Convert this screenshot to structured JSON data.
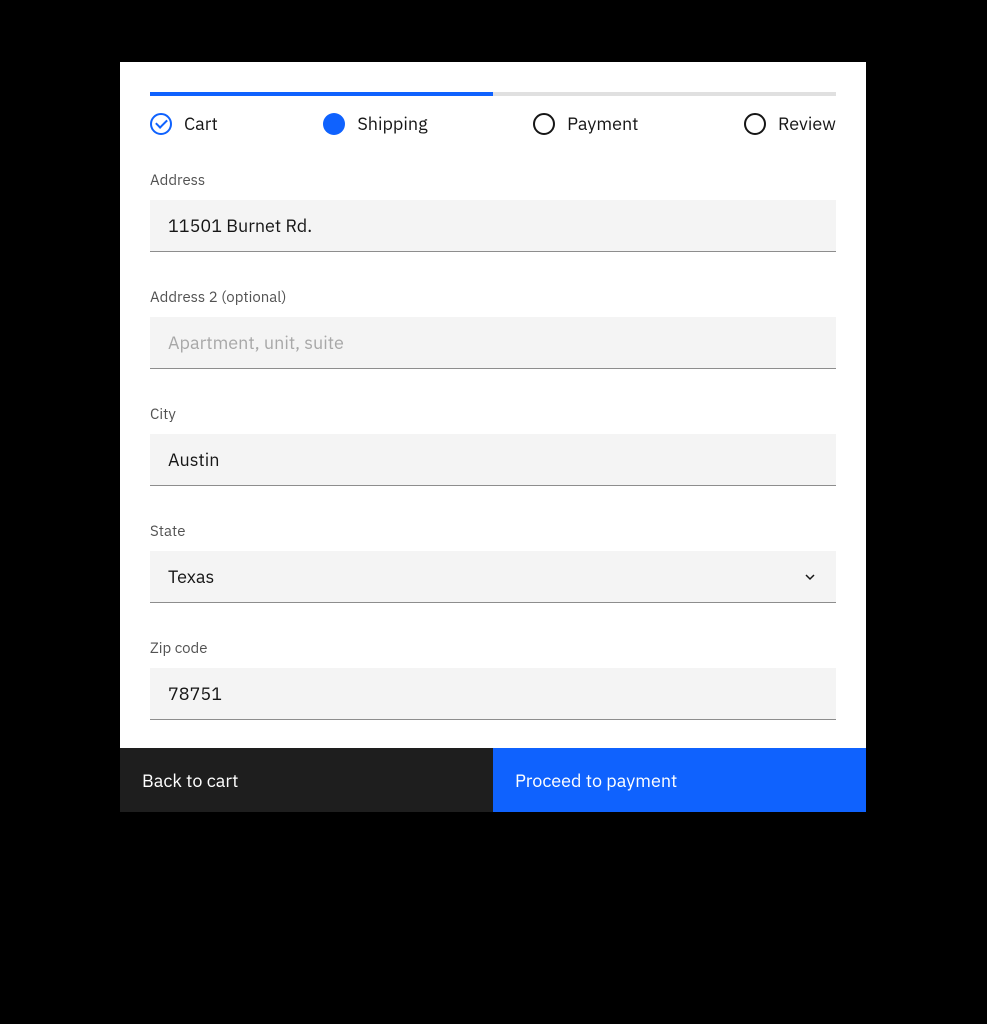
{
  "progress": {
    "fill_percent": 50,
    "steps": [
      {
        "label": "Cart",
        "state": "complete"
      },
      {
        "label": "Shipping",
        "state": "current"
      },
      {
        "label": "Payment",
        "state": "incomplete"
      },
      {
        "label": "Review",
        "state": "incomplete"
      }
    ]
  },
  "form": {
    "address": {
      "label": "Address",
      "value": "11501 Burnet Rd."
    },
    "address2": {
      "label": "Address 2 (optional)",
      "value": "",
      "placeholder": "Apartment, unit, suite"
    },
    "city": {
      "label": "City",
      "value": "Austin"
    },
    "state": {
      "label": "State",
      "value": "Texas"
    },
    "zip": {
      "label": "Zip code",
      "value": "78751"
    }
  },
  "buttons": {
    "back": "Back to cart",
    "next": "Proceed to payment"
  }
}
